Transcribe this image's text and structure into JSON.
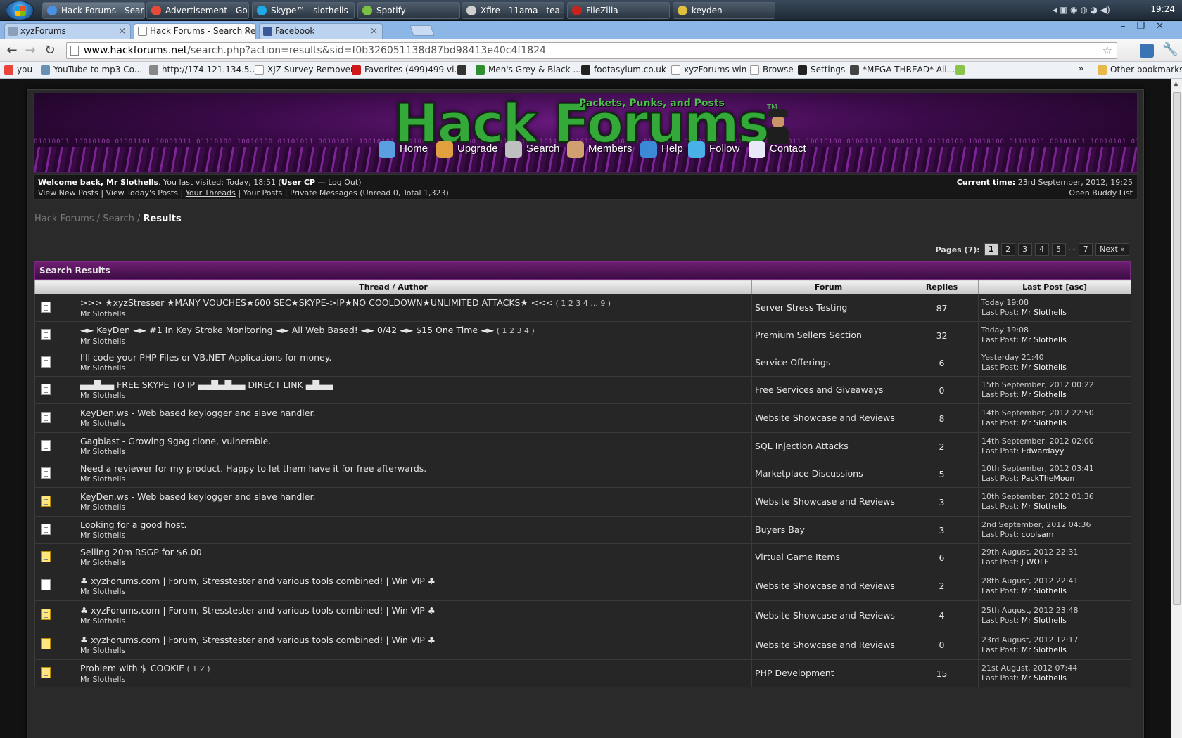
{
  "taskbar": {
    "tasks": [
      {
        "label": "Hack Forums - Sear...",
        "color": "#4a90e2"
      },
      {
        "label": "Advertisement - Go...",
        "color": "#e84a3a"
      },
      {
        "label": "Skype™ - slothells",
        "color": "#1fa9e5"
      },
      {
        "label": "Spotify",
        "color": "#7bc043"
      },
      {
        "label": "Xfire - 11ama - tea...",
        "color": "#d0d0d0"
      },
      {
        "label": "FileZilla",
        "color": "#c8241b"
      },
      {
        "label": "keyden",
        "color": "#e0c040"
      }
    ],
    "clock": "19:24"
  },
  "browser": {
    "tabs": [
      {
        "label": "xyzForums",
        "color": "#8aa0b8"
      },
      {
        "label": "Hack Forums - Search Resu",
        "color": "#ffffff"
      },
      {
        "label": "Facebook",
        "color": "#3b5998"
      }
    ],
    "url_host": "www.hackforums.net",
    "url_path": "/search.php?action=results&sid=f0b326051138d87bd98413e40c4f1824",
    "bookmarks": [
      {
        "label": "you",
        "color": "#e8443a"
      },
      {
        "label": "YouTube to mp3 Co...",
        "color": "#6a8fb5"
      },
      {
        "label": "http://174.121.134.5...",
        "color": "#888888"
      },
      {
        "label": "XJZ Survey Remover",
        "color": "#ffffff"
      },
      {
        "label": "Favorites (499)499 vi...",
        "color": "#cc1a1a"
      },
      {
        "label": "",
        "color": "#333333"
      },
      {
        "label": "Men's Grey & Black ...",
        "color": "#2f8f2f"
      },
      {
        "label": "footasylum.co.uk",
        "color": "#222222"
      },
      {
        "label": "xyzForums win",
        "color": "#ffffff"
      },
      {
        "label": "Browse",
        "color": "#ffffff"
      },
      {
        "label": "Settings",
        "color": "#222222"
      },
      {
        "label": "*MEGA THREAD* All...",
        "color": "#444444"
      },
      {
        "label": "",
        "color": "#8bc34a"
      }
    ],
    "bookmarks_more": "»",
    "other_bookmarks": "Other bookmarks"
  },
  "site": {
    "logo": "Hack Forums",
    "tagline": "Packets, Punks, and Posts",
    "tm": "TM",
    "binary": "01010011 10010100 01001101 10001011 01110100 10010100 01101011 00101011 10010101 01010011 10010100 01001101 10001011 01110100 10010100 01101011 00101011 10010101 01010011 10010100 01001101 10001011 01110100 10010100 01101011 00101011 10010101 01010011 10010100 01001101 10001011 01110100 10010100 01101011 00101011 10010101 01010011",
    "nav": [
      {
        "label": "Home",
        "color": "#5aa0e0"
      },
      {
        "label": "Upgrade",
        "color": "#e0a040"
      },
      {
        "label": "Search",
        "color": "#c0c0c0"
      },
      {
        "label": "Members",
        "color": "#d0a070"
      },
      {
        "label": "Help",
        "color": "#3a8ad8"
      },
      {
        "label": "Follow",
        "color": "#4ab0e8"
      },
      {
        "label": "Contact",
        "color": "#e8e8f8"
      }
    ]
  },
  "welcome": {
    "welcome_back": "Welcome back, Mr Slothells",
    "last_visited": ". You last visited: Today, 18:51 (",
    "user_cp": "User CP",
    "dash": " — ",
    "logout": "Log Out",
    "close_paren": ")",
    "view_new": "View New Posts",
    "view_today": "View Today's Posts",
    "your_threads": "Your Threads",
    "your_posts": "Your Posts",
    "pm": "Private Messages",
    "pm_counts": "(Unread 0, Total 1,323)",
    "sep": " | ",
    "current_time_label": "Current time:",
    "current_time": "23rd September, 2012, 19:25",
    "buddy_list": "Open Buddy List"
  },
  "breadcrumb": {
    "items": [
      "Hack Forums",
      "Search"
    ],
    "separator": " / ",
    "current": "Results"
  },
  "pager": {
    "label": "Pages (7):",
    "pages": [
      "1",
      "2",
      "3",
      "4",
      "5",
      "...",
      "7"
    ],
    "current": "1",
    "next": "Next »"
  },
  "results": {
    "title": "Search Results",
    "columns": {
      "thread_author": "Thread / Author",
      "forum": "Forum",
      "replies": "Replies",
      "last_post": "Last Post",
      "sort": "[asc]"
    },
    "last_post_prefix": "Last Post:",
    "rows": [
      {
        "hot": false,
        "title": ">>> ★xyzStresser ★MANY VOUCHES★600 SEC★SKYPE->IP★NO COOLDOWN★UNLIMITED ATTACKS★ <<<",
        "pages": " ( 1 2 3 4 ... 9 )",
        "author": "Mr Slothells",
        "forum": "Server Stress Testing",
        "replies": "87",
        "last_time": "Today 19:08",
        "last_by": "Mr Slothells"
      },
      {
        "hot": false,
        "title": "◄► KeyDen ◄► #1 In Key Stroke Monitoring ◄► All Web Based! ◄► 0/42 ◄► $15 One Time ◄►",
        "pages": " ( 1 2 3 4 )",
        "author": "Mr Slothells",
        "forum": "Premium Sellers Section",
        "replies": "32",
        "last_time": "Today 19:08",
        "last_by": "Mr Slothells"
      },
      {
        "hot": false,
        "title": "I'll code your PHP Files or VB.NET Applications for money.",
        "pages": "",
        "author": "Mr Slothells",
        "forum": "Service Offerings",
        "replies": "6",
        "last_time": "Yesterday 21:40",
        "last_by": "Mr Slothells"
      },
      {
        "hot": false,
        "title": "▄▄█▄▄ FREE SKYPE TO IP ▄▄█▄█▄▄ DIRECT LINK ▄█▄▄",
        "pages": "",
        "author": "Mr Slothells",
        "forum": "Free Services and Giveaways",
        "replies": "0",
        "last_time": "15th September, 2012 00:22",
        "last_by": "Mr Slothells"
      },
      {
        "hot": false,
        "title": "KeyDen.ws - Web based keylogger and slave handler.",
        "pages": "",
        "author": "Mr Slothells",
        "forum": "Website Showcase and Reviews",
        "replies": "8",
        "last_time": "14th September, 2012 22:50",
        "last_by": "Mr Slothells"
      },
      {
        "hot": false,
        "title": "Gagblast - Growing 9gag clone, vulnerable.",
        "pages": "",
        "author": "Mr Slothells",
        "forum": "SQL Injection Attacks",
        "replies": "2",
        "last_time": "14th September, 2012 02:00",
        "last_by": "Edwardayy"
      },
      {
        "hot": false,
        "title": "Need a reviewer for my product. Happy to let them have it for free afterwards.",
        "pages": "",
        "author": "Mr Slothells",
        "forum": "Marketplace Discussions",
        "replies": "5",
        "last_time": "10th September, 2012 03:41",
        "last_by": "PackTheMoon"
      },
      {
        "hot": true,
        "title": "KeyDen.ws - Web based keylogger and slave handler.",
        "pages": "",
        "author": "Mr Slothells",
        "forum": "Website Showcase and Reviews",
        "replies": "3",
        "last_time": "10th September, 2012 01:36",
        "last_by": "Mr Slothells"
      },
      {
        "hot": false,
        "title": "Looking for a good host.",
        "pages": "",
        "author": "Mr Slothells",
        "forum": "Buyers Bay",
        "replies": "3",
        "last_time": "2nd September, 2012 04:36",
        "last_by": "coolsam"
      },
      {
        "hot": true,
        "title": "Selling 20m RSGP for $6.00",
        "pages": "",
        "author": "Mr Slothells",
        "forum": "Virtual Game Items",
        "replies": "6",
        "last_time": "29th August, 2012 22:31",
        "last_by": "J WOLF"
      },
      {
        "hot": false,
        "title": "♣ xyzForums.com | Forum, Stresstester and various tools combined! | Win VIP ♣",
        "pages": "",
        "author": "Mr Slothells",
        "forum": "Website Showcase and Reviews",
        "replies": "2",
        "last_time": "28th August, 2012 22:41",
        "last_by": "Mr Slothells"
      },
      {
        "hot": true,
        "title": "♣ xyzForums.com | Forum, Stresstester and various tools combined! | Win VIP ♣",
        "pages": "",
        "author": "Mr Slothells",
        "forum": "Website Showcase and Reviews",
        "replies": "4",
        "last_time": "25th August, 2012 23:48",
        "last_by": "Mr Slothells"
      },
      {
        "hot": true,
        "title": "♣ xyzForums.com | Forum, Stresstester and various tools combined! | Win VIP ♣",
        "pages": "",
        "author": "Mr Slothells",
        "forum": "Website Showcase and Reviews",
        "replies": "0",
        "last_time": "23rd August, 2012 12:17",
        "last_by": "Mr Slothells"
      },
      {
        "hot": true,
        "title": "Problem with $_COOKIE",
        "pages": " ( 1 2 )",
        "author": "Mr Slothells",
        "forum": "PHP Development",
        "replies": "15",
        "last_time": "21st August, 2012 07:44",
        "last_by": "Mr Slothells"
      }
    ]
  }
}
